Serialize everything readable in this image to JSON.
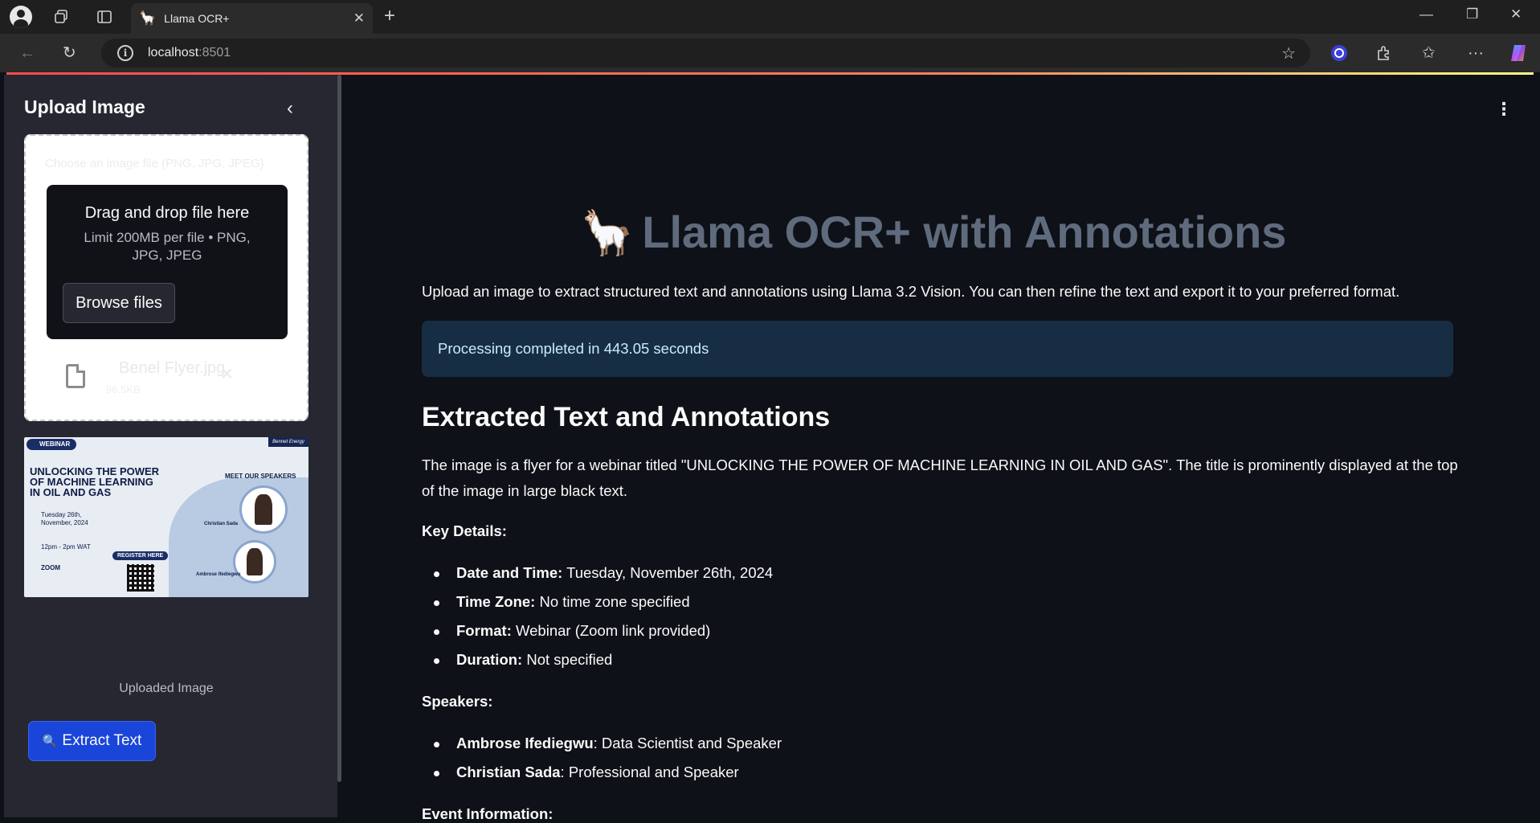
{
  "browser": {
    "tab_title": "Llama OCR+",
    "tab_favicon": "🦙",
    "url_host": "localhost",
    "url_port": ":8501"
  },
  "sidebar": {
    "upload_title": "Upload Image",
    "uploader_label": "Choose an image file (PNG, JPG, JPEG)",
    "dropzone_title": "Drag and drop file here",
    "dropzone_limit": "Limit 200MB per file • PNG, JPG, JPEG",
    "browse_label": "Browse files",
    "file_name": "Benel Flyer.jpg",
    "file_size": "96.5KB",
    "image_caption": "Uploaded Image",
    "extract_label": "Extract Text"
  },
  "thumbnail": {
    "badge": "WEBINAR",
    "brand": "Bennet Energy",
    "headline": "UNLOCKING THE POWER OF MACHINE LEARNING IN OIL AND GAS",
    "meet": "MEET OUR SPEAKERS",
    "date": "Tuesday 26th, November, 2024",
    "time": "12pm - 2pm WAT",
    "register": "REGISTER HERE",
    "venue": "ZOOM",
    "speaker1": "Christian Sada",
    "speaker2": "Ambrose Ifediegwu"
  },
  "main": {
    "title": "Llama OCR+ with Annotations",
    "title_emoji": "🦙",
    "intro": "Upload an image to extract structured text and annotations using Llama 3.2 Vision. You can then refine the text and export it to your preferred format.",
    "status": "Processing completed in 443.05 seconds",
    "section_heading": "Extracted Text and Annotations",
    "paragraph": "The image is a flyer for a webinar titled \"UNLOCKING THE POWER OF MACHINE LEARNING IN OIL AND GAS\". The title is prominently displayed at the top of the image in large black text.",
    "key_details_label": "Key Details:",
    "key_details": [
      {
        "term": "Date and Time:",
        "value": " Tuesday, November 26th, 2024"
      },
      {
        "term": "Time Zone:",
        "value": " No time zone specified"
      },
      {
        "term": "Format:",
        "value": " Webinar (Zoom link provided)"
      },
      {
        "term": "Duration:",
        "value": " Not specified"
      }
    ],
    "speakers_label": "Speakers:",
    "speakers": [
      {
        "term": "Ambrose Ifediegwu",
        "value": ": Data Scientist and Speaker"
      },
      {
        "term": "Christian Sada",
        "value": ": Professional and Speaker"
      }
    ],
    "event_info_label": "Event Information:"
  },
  "colors": {
    "primary_button": "#1a45d9",
    "info_alert_bg": "#172d43",
    "sidebar_bg": "#262730",
    "main_bg": "#0e1117"
  }
}
